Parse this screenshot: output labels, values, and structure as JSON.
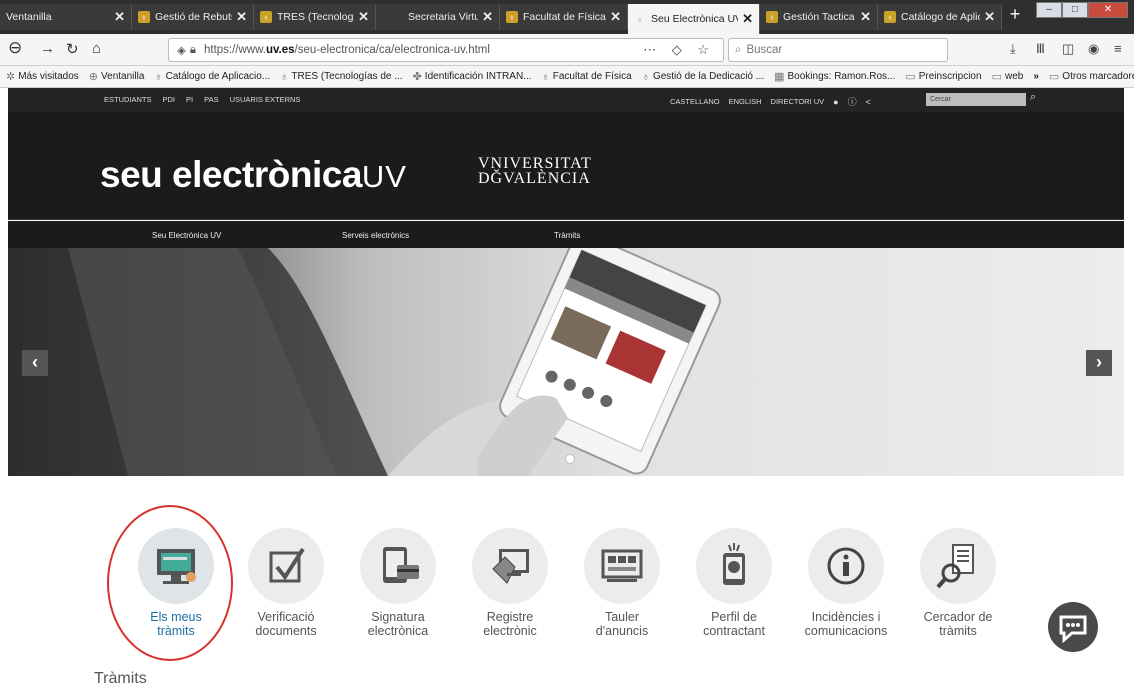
{
  "browser": {
    "tabs": [
      {
        "title": "Ventanilla",
        "favicon": false,
        "active": false
      },
      {
        "title": "Gestió de Rebuts",
        "favicon": true,
        "active": false
      },
      {
        "title": "TRES (Tecnologia…",
        "favicon": true,
        "active": false
      },
      {
        "title": "Secretaria Virtual",
        "favicon": false,
        "active": false
      },
      {
        "title": "Facultat de Física",
        "favicon": true,
        "active": false
      },
      {
        "title": "Seu Electrònica UV",
        "favicon": true,
        "active": true
      },
      {
        "title": "Gestión Tactica",
        "favicon": true,
        "active": false
      },
      {
        "title": "Catálogo de Aplic…",
        "favicon": true,
        "active": false
      }
    ],
    "url_prefix": "https://www.",
    "url_host": "uv.es",
    "url_path": "/seu-electronica/ca/electronica-uv.html",
    "search_placeholder": "Buscar",
    "bookmarks": [
      "Más visitados",
      "Ventanilla",
      "Catálogo de Aplicacio...",
      "TRES (Tecnologías de ...",
      "Identificación INTRAN...",
      "Facultat de Física",
      "Gestió de la Dedicació ...",
      "Bookings: Ramon.Ros...",
      "Preinscripcion",
      "web"
    ],
    "other_bookmarks": "Otros marcadores"
  },
  "site": {
    "top_links_left": [
      "ESTUDIANTS",
      "PDI",
      "PI",
      "PAS",
      "USUARIS EXTERNS"
    ],
    "top_links_right": [
      "CASTELLANO",
      "ENGLISH",
      "DIRECTORI UV"
    ],
    "search_placeholder": "Cercar",
    "logo_main": "seu electrònica",
    "logo_suffix": "UV",
    "univ_line1": "VNIVERSITAT",
    "univ_line2": "DĞVALÈNCIA",
    "menu": [
      "Seu Electrònica UV",
      "Serveis electrònics",
      "Tràmits"
    ],
    "services": [
      {
        "line1": "Els meus",
        "line2": "tràmits",
        "icon": "monitor-icon"
      },
      {
        "line1": "Verificació",
        "line2": "documents",
        "icon": "checkbox-icon"
      },
      {
        "line1": "Signatura",
        "line2": "electrònica",
        "icon": "tablet-card-icon"
      },
      {
        "line1": "Registre",
        "line2": "electrònic",
        "icon": "register-icon"
      },
      {
        "line1": "Tauler",
        "line2": "d'anuncis",
        "icon": "noticeboard-icon"
      },
      {
        "line1": "Perfil de",
        "line2": "contractant",
        "icon": "profile-icon"
      },
      {
        "line1": "Incidències i",
        "line2": "comunicacions",
        "icon": "info-icon"
      },
      {
        "line1": "Cercador de",
        "line2": "tràmits",
        "icon": "search-document-icon"
      }
    ],
    "section_title": "Tràmits"
  }
}
